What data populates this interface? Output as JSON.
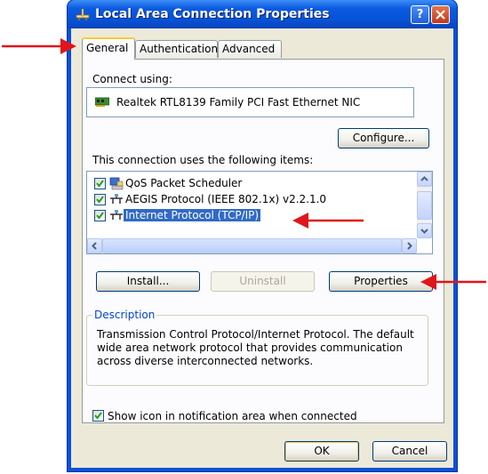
{
  "window": {
    "title": "Local Area Connection Properties",
    "help_label": "?",
    "close_label": "✕"
  },
  "tabs": [
    {
      "label": "General",
      "active": true
    },
    {
      "label": "Authentication",
      "active": false
    },
    {
      "label": "Advanced",
      "active": false
    }
  ],
  "general": {
    "connect_using_label": "Connect using:",
    "adapter_name": "Realtek RTL8139 Family PCI Fast Ethernet NIC",
    "configure_label": "Configure...",
    "items_label": "This connection uses the following items:",
    "items": [
      {
        "label": "QoS Packet Scheduler",
        "checked": true,
        "selected": false,
        "icon": "scheduler-icon"
      },
      {
        "label": "AEGIS Protocol (IEEE 802.1x) v2.2.1.0",
        "checked": true,
        "selected": false,
        "icon": "network-protocol-icon"
      },
      {
        "label": "Internet Protocol (TCP/IP)",
        "checked": true,
        "selected": true,
        "icon": "network-protocol-icon"
      }
    ],
    "install_label": "Install...",
    "uninstall_label": "Uninstall",
    "properties_label": "Properties",
    "description_title": "Description",
    "description_text": "Transmission Control Protocol/Internet Protocol. The default wide area network protocol that provides communication across diverse interconnected networks.",
    "notify_label": "Show icon in notification area when connected",
    "notify_checked": true
  },
  "footer": {
    "ok_label": "OK",
    "cancel_label": "Cancel"
  },
  "colors": {
    "annotation_arrow": "#e0161a",
    "selection": "#316ac5",
    "titlebar": "#0653d7"
  }
}
